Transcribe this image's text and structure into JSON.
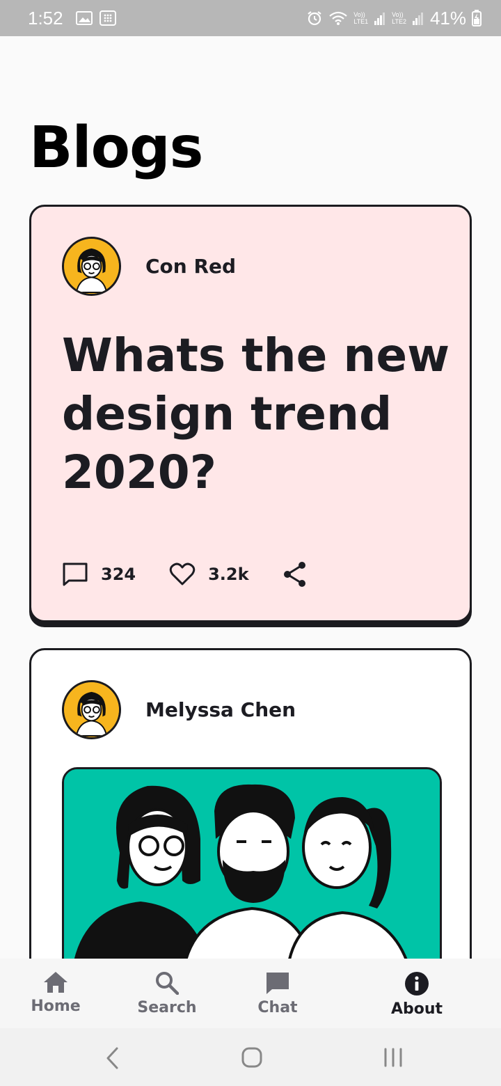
{
  "status_bar": {
    "time": "1:52",
    "lte1": "LTE1",
    "lte2": "LTE2",
    "volte": "Vo))",
    "battery": "41%"
  },
  "page": {
    "title": "Blogs"
  },
  "posts": [
    {
      "author": "Con Red",
      "title": "Whats the new design trend 2020?",
      "comments": "324",
      "likes": "3.2k",
      "background": "#ffe7e8"
    },
    {
      "author": "Melyssa Chen",
      "image": "three-people-illustration",
      "image_background": "#00c4a7",
      "background": "#ffffff"
    }
  ],
  "bottom_nav": {
    "items": [
      {
        "label": "Home",
        "icon": "home-icon"
      },
      {
        "label": "Search",
        "icon": "search-icon"
      },
      {
        "label": "Chat",
        "icon": "chat-icon"
      },
      {
        "label": "About",
        "icon": "info-icon",
        "active": true
      }
    ]
  },
  "system_nav": {
    "buttons": [
      "back-icon",
      "home-circle-icon",
      "recents-icon"
    ]
  },
  "colors": {
    "accent_yellow": "#f7b51e",
    "teal": "#00c4a7",
    "ink": "#1c1c22"
  }
}
